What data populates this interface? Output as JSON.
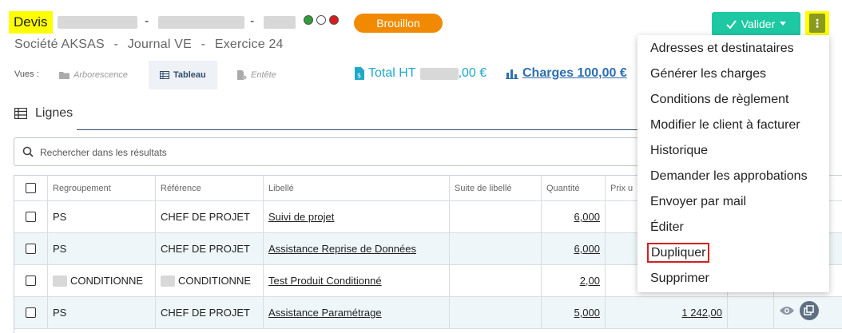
{
  "header": {
    "doc_type": "Devis",
    "separator": "-",
    "status": "Brouillon",
    "valider_label": "Valider",
    "kebab_label": "⋮"
  },
  "subtitle": {
    "company": "Société AKSAS",
    "journal": "Journal VE",
    "exercice": "Exercice 24",
    "separator": "-"
  },
  "views": {
    "label": "Vues :",
    "tabs": [
      "Arborescence",
      "Tableau",
      "Entête"
    ],
    "active": "Tableau"
  },
  "totals": {
    "total_ht_label": "Total HT",
    "total_ht_suffix": ",00 €",
    "charges": "Charges 100,00 €"
  },
  "lignes": {
    "title": "Lignes"
  },
  "search": {
    "placeholder": "Rechercher dans les résultats"
  },
  "table": {
    "columns": [
      "Regroupement",
      "Référence",
      "Libellé",
      "Suite de libellé",
      "Quantité",
      "Prix u"
    ],
    "rows": [
      {
        "regroupement": "PS",
        "reference": "CHEF DE PROJET",
        "libelle": "Suivi de projet",
        "suite": "",
        "quantite": "6,000",
        "prix": ""
      },
      {
        "regroupement": "PS",
        "reference": "CHEF DE PROJET",
        "libelle": "Assistance Reprise de Données",
        "suite": "",
        "quantite": "6,000",
        "prix": ""
      },
      {
        "regroupement": "CONDITIONNE",
        "reference": "CONDITIONNE",
        "libelle": "Test Produit Conditionné",
        "suite": "",
        "quantite": "2,00",
        "prix": ""
      },
      {
        "regroupement": "PS",
        "reference": "CHEF DE PROJET",
        "libelle": "Assistance Paramétrage",
        "suite": "",
        "quantite": "5,000",
        "prix": "1 242,00"
      }
    ]
  },
  "menu": {
    "items": [
      "Adresses et destinataires",
      "Générer les charges",
      "Conditions de règlement",
      "Modifier le client à facturer",
      "Historique",
      "Demander les approbations",
      "Envoyer par mail",
      "Éditer",
      "Dupliquer",
      "Supprimer"
    ],
    "highlighted": "Dupliquer"
  },
  "colors": {
    "status_badge": "#f18a00",
    "valider_button": "#1dc8a2",
    "highlight_yellow": "#ffff00",
    "total_ht": "#1fa9c9",
    "charges_link": "#2f6fb0",
    "menu_highlight_border": "#d32020",
    "dot_green": "#2e9e3a",
    "dot_white": "#ffffff",
    "dot_red": "#d81b1b"
  }
}
